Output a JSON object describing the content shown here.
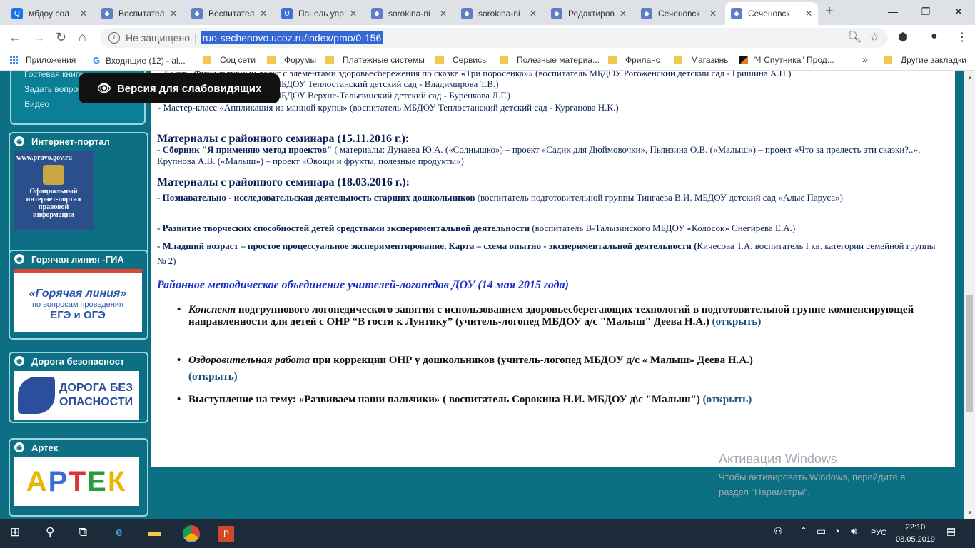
{
  "browser": {
    "tabs": [
      {
        "title": "мбдоу сол",
        "icon": "search-icon",
        "color": "#1a73e8",
        "glyph": "Q"
      },
      {
        "title": "Воспитател",
        "icon": "site-icon",
        "color": "#5f7ec9",
        "glyph": "◆"
      },
      {
        "title": "Воспитател",
        "icon": "site-icon",
        "color": "#5f7ec9",
        "glyph": "◆"
      },
      {
        "title": "Панель упр",
        "icon": "ucoz-icon",
        "color": "#3d6fd8",
        "glyph": "U"
      },
      {
        "title": "sorokina-ni",
        "icon": "site-icon",
        "color": "#5f7ec9",
        "glyph": "◆"
      },
      {
        "title": "sorokina-ni",
        "icon": "site-icon",
        "color": "#5f7ec9",
        "glyph": "◆"
      },
      {
        "title": "Редактиров",
        "icon": "site-icon",
        "color": "#5f7ec9",
        "glyph": "◆"
      },
      {
        "title": "Сеченовск",
        "icon": "site-icon",
        "color": "#5f7ec9",
        "glyph": "◆"
      },
      {
        "title": "Сеченовск",
        "icon": "site-icon",
        "color": "#5f7ec9",
        "glyph": "◆",
        "active": true
      }
    ],
    "insecure_label": "Не защищено",
    "url": "ruo-sechenovo.ucoz.ru/index/pmo/0-156"
  },
  "bookmarks": [
    {
      "label": "Приложения",
      "kind": "apps"
    },
    {
      "label": "Входящие (12) - al...",
      "kind": "google"
    },
    {
      "label": "Соц сети",
      "kind": "folder"
    },
    {
      "label": "Форумы",
      "kind": "folder"
    },
    {
      "label": "Платежные системы",
      "kind": "folder"
    },
    {
      "label": "Сервисы",
      "kind": "folder"
    },
    {
      "label": "Полезные материа...",
      "kind": "folder"
    },
    {
      "label": "Фриланс",
      "kind": "folder"
    },
    {
      "label": "Магазины",
      "kind": "folder"
    },
    {
      "label": "\"4 Спутника\" Прод...",
      "kind": "orange"
    },
    {
      "label": "Другие закладки",
      "kind": "folder"
    }
  ],
  "sidebar": {
    "links": [
      "Гостевая книга",
      "Задать вопрос",
      "Видео"
    ],
    "blocks": [
      {
        "title": "Интернет-портал",
        "img_lines": [
          "www.pravo.gov.ru",
          "Официальный",
          "интернет-портал",
          "правовой",
          "информации"
        ]
      },
      {
        "title": "Горячая линия -ГИА",
        "img_lines": [
          "«Горячая линия»",
          "по вопросам проведения",
          "ЕГЭ и ОГЭ"
        ]
      },
      {
        "title": "Дорога безопасност",
        "img_lines": [
          "ДОРОГА БЕЗ",
          "ОПАСНОСТИ"
        ]
      },
      {
        "title": "Артек",
        "img_lines": [
          "АРТЕК"
        ]
      }
    ]
  },
  "accessibility_button": "Версия для слабовидящих",
  "content": {
    "top_lines": [
      "- Досуг «Физкультурный досуг с элементами здоровьесбережения по сказке «Три поросенка»» (воспитатель МБДОУ Рогоженский детский сад - Гришина А.П.)",
      "- Мастер-класс (воспитатель МБДОУ Теплостанский детский сад - Владимирова Т.В.)",
      "- Мастер-класс (воспитатель МБДОУ Верхне-Талызинский детский сад - Буренкова Л.Г.)",
      "- Мастер-класс «Аппликация из манной крупы» (воспитатель МБДОУ Теплостанский детский сад - Курганова Н.К.)"
    ],
    "seminar1": {
      "title": "Материалы с районного семинара (15.11.2016 г.):",
      "bold": "- Сборник \"Я применяю метод проектов\"",
      "rest": " ( материалы: Дунаева Ю.А. («Солнышко») – проект «Садик для Дюймовочки», Пьянзина О.В. («Малыш») – проект «Что за прелесть эти сказки?..», Крупнова А.В. («Малыш») – проект «Овощи и фрукты, полезные продукты»)"
    },
    "seminar2": {
      "title": "Материалы с районного семинара (18.03.2016 г.):",
      "items": [
        {
          "bold": "- Познавательно - исследовательская деятельность старших дошкольников",
          "rest": " (воспитатель подготовительной группы Тингаева В.И. МБДОУ детский сад «Алые Паруса»)"
        },
        {
          "bold": "- Развитие творческих способностей детей средствами экспериментальной деятельности",
          "rest": " (воспитатель В-Талызинского МБДОУ «Колосок» Снегирева Е.А.)"
        },
        {
          "bold": "- Младший возраст – простое процессуальное экспериментирование, Карта – схема опытно - экспериментальной деятельности (",
          "rest": "Кичесова Т.А. воспитатель I кв. категории семейной группы № 2)"
        }
      ]
    },
    "rmo_title": "Районное методическое объединение учителей-логопедов ДОУ (14 мая 2015 года)",
    "bullets": [
      {
        "italic": "Конспект",
        "text": " подгруппового логопедического занятия с использованием здоровьесберегающих технологий в подготовительной группе компенсирующей направленности для детей с ОНР “В гости к Лунтику” (учитель-логопед МБДОУ д/с \"Малыш\" Деева Н.А.) ",
        "link": "(открыть)"
      },
      {
        "italic": "Оздоровительная работа",
        "text": " при коррекции ОНР у дошкольников (учитель-логопед МБДОУ д/с « Малыш» Деева Н.А.) ",
        "link": "(открыть)"
      },
      {
        "italic": "",
        "text": "Выступление на тему: «Развиваем наши пальчики» ( воспитатель Сорокина Н.И. МБДОУ д\\с \"Малыш\") ",
        "link": "(открыть)"
      }
    ]
  },
  "watermark": {
    "title": "Активация Windows",
    "line1": "Чтобы активировать Windows, перейдите в",
    "line2": "раздел \"Параметры\"."
  },
  "taskbar": {
    "lang": "РУС",
    "time": "22:10",
    "date": "08.05.2019"
  }
}
